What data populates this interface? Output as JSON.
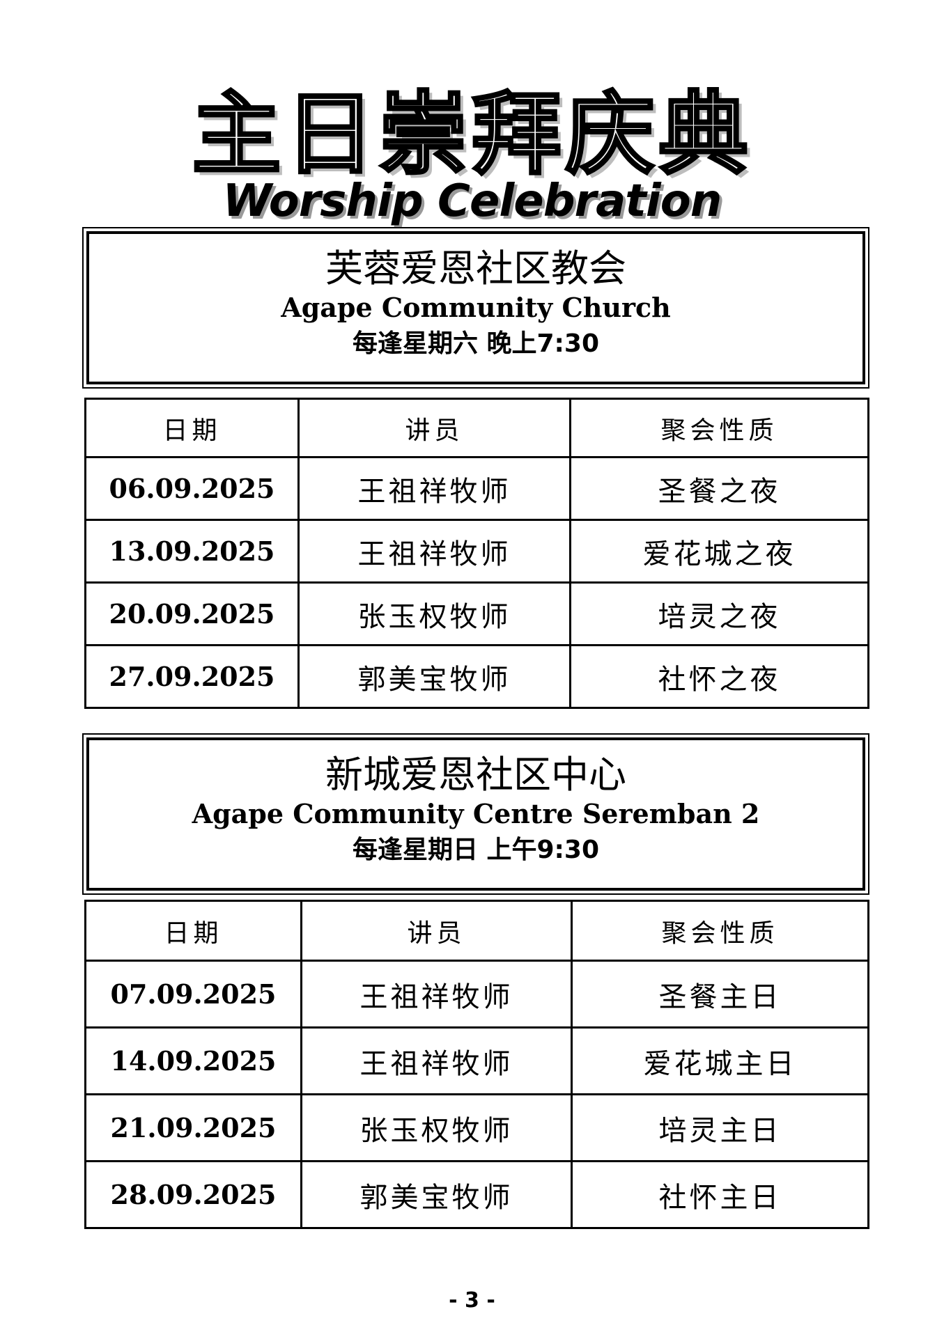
{
  "header": {
    "title_cn": "主日崇拜庆典",
    "title_en": "Worship Celebration"
  },
  "church1": {
    "name_cn": "芙蓉爱恩社区教会",
    "name_en": "Agape Community Church",
    "time": "每逢星期六  晚上7:30"
  },
  "table1": {
    "headers": [
      "日期",
      "讲员",
      "聚会性质"
    ],
    "rows": [
      [
        "06.09.2025",
        "王祖祥牧师",
        "圣餐之夜"
      ],
      [
        "13.09.2025",
        "王祖祥牧师",
        "爱花城之夜"
      ],
      [
        "20.09.2025",
        "张玉权牧师",
        "培灵之夜"
      ],
      [
        "27.09.2025",
        "郭美宝牧师",
        "社怀之夜"
      ]
    ]
  },
  "church2": {
    "name_cn": "新城爱恩社区中心",
    "name_en": "Agape Community Centre Seremban 2",
    "time": "每逢星期日  上午9:30"
  },
  "table2": {
    "headers": [
      "日期",
      "讲员",
      "聚会性质"
    ],
    "rows": [
      [
        "07.09.2025",
        "王祖祥牧师",
        "圣餐主日"
      ],
      [
        "14.09.2025",
        "王祖祥牧师",
        "爱花城主日"
      ],
      [
        "21.09.2025",
        "张玉权牧师",
        "培灵主日"
      ],
      [
        "28.09.2025",
        "郭美宝牧师",
        "社怀主日"
      ]
    ]
  },
  "footer": {
    "page_number": "- 3 -"
  }
}
